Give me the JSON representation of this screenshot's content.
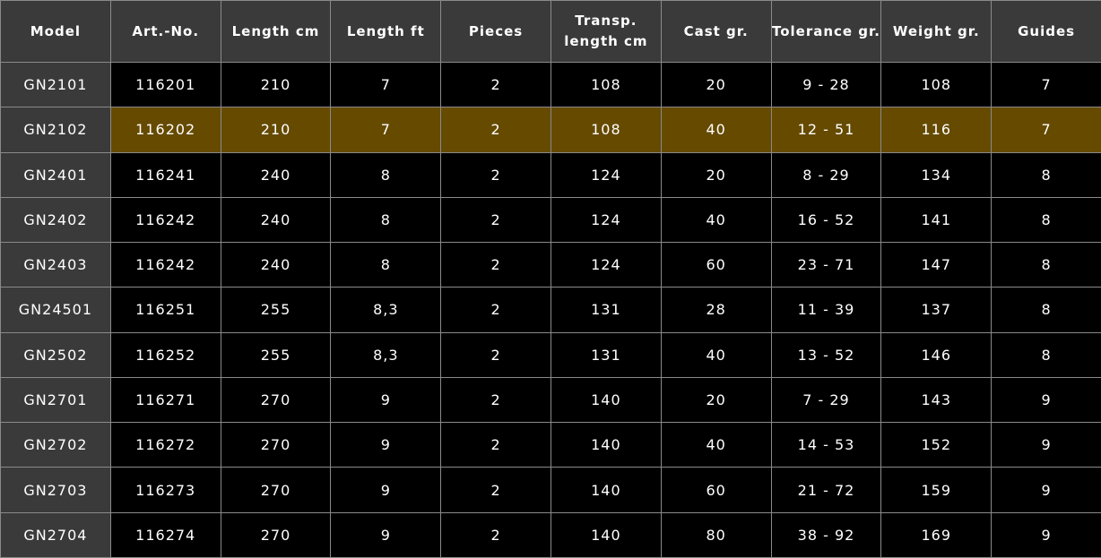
{
  "table": {
    "columns": [
      "Model",
      "Art.-No.",
      "Length cm",
      "Length ft",
      "Pieces",
      "Transp. length cm",
      "Cast gr.",
      "Tolerance gr.",
      "Weight gr.",
      "Guides"
    ],
    "highlighted_row": 1,
    "rows": [
      [
        "GN2101",
        "116201",
        "210",
        "7",
        "2",
        "108",
        "20",
        "9 - 28",
        "108",
        "7"
      ],
      [
        "GN2102",
        "116202",
        "210",
        "7",
        "2",
        "108",
        "40",
        "12 - 51",
        "116",
        "7"
      ],
      [
        "GN2401",
        "116241",
        "240",
        "8",
        "2",
        "124",
        "20",
        "8 - 29",
        "134",
        "8"
      ],
      [
        "GN2402",
        "116242",
        "240",
        "8",
        "2",
        "124",
        "40",
        "16 - 52",
        "141",
        "8"
      ],
      [
        "GN2403",
        "116242",
        "240",
        "8",
        "2",
        "124",
        "60",
        "23 - 71",
        "147",
        "8"
      ],
      [
        "GN24501",
        "116251",
        "255",
        "8,3",
        "2",
        "131",
        "28",
        "11 - 39",
        "137",
        "8"
      ],
      [
        "GN2502",
        "116252",
        "255",
        "8,3",
        "2",
        "131",
        "40",
        "13 - 52",
        "146",
        "8"
      ],
      [
        "GN2701",
        "116271",
        "270",
        "9",
        "2",
        "140",
        "20",
        "7 - 29",
        "143",
        "9"
      ],
      [
        "GN2702",
        "116272",
        "270",
        "9",
        "2",
        "140",
        "40",
        "14 - 53",
        "152",
        "9"
      ],
      [
        "GN2703",
        "116273",
        "270",
        "9",
        "2",
        "140",
        "60",
        "21 - 72",
        "159",
        "9"
      ],
      [
        "GN2704",
        "116274",
        "270",
        "9",
        "2",
        "140",
        "80",
        "38 - 92",
        "169",
        "9"
      ]
    ]
  },
  "colors": {
    "header_bg": "#3a3a3a",
    "model_cell_bg": "#3a3a3a",
    "cell_bg": "#000000",
    "highlight_bg": "#654a00",
    "border": "#8a8a8a",
    "text": "#ffffff"
  }
}
